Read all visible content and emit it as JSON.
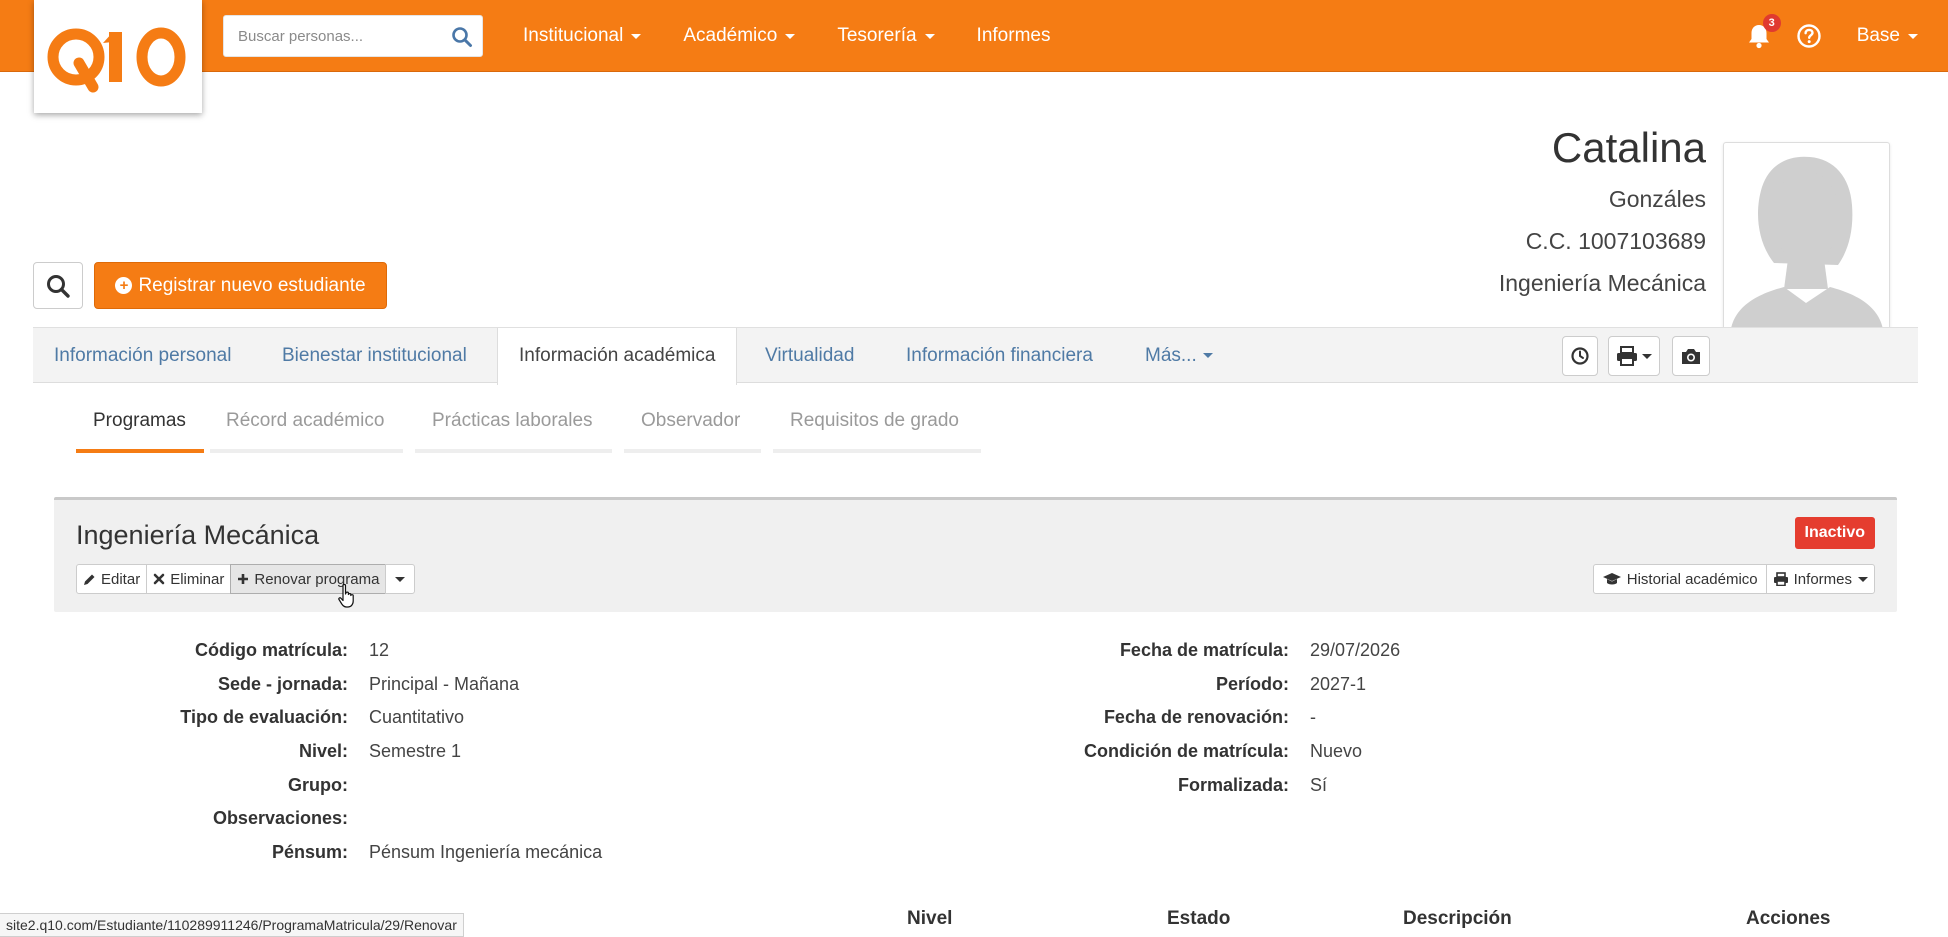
{
  "navbar": {
    "logo_text": "Q10",
    "search_placeholder": "Buscar personas...",
    "menu": [
      {
        "label": "Institucional",
        "has_caret": true
      },
      {
        "label": "Académico",
        "has_caret": true
      },
      {
        "label": "Tesorería",
        "has_caret": true
      },
      {
        "label": "Informes",
        "has_caret": false
      }
    ],
    "notifications_count": "3",
    "user_label": "Base",
    "icons": [
      "search-icon",
      "bell-icon",
      "question-circle-icon",
      "caret-down-icon"
    ]
  },
  "profile": {
    "first_name": "Catalina",
    "last_name": "Gonzáles",
    "document": "C.C. 1007103689",
    "program": "Ingeniería Mecánica"
  },
  "actions": {
    "register_label": "Registrar nuevo estudiante"
  },
  "main_tabs": [
    {
      "label": "Información personal",
      "active": false
    },
    {
      "label": "Bienestar institucional",
      "active": false
    },
    {
      "label": "Información académica",
      "active": true
    },
    {
      "label": "Virtualidad",
      "active": false
    },
    {
      "label": "Información financiera",
      "active": false
    },
    {
      "label": "Más...",
      "active": false
    }
  ],
  "sub_tabs": [
    {
      "label": "Programas",
      "active": true
    },
    {
      "label": "Récord académico",
      "active": false
    },
    {
      "label": "Prácticas laborales",
      "active": false
    },
    {
      "label": "Observador",
      "active": false
    },
    {
      "label": "Requisitos de grado",
      "active": false
    }
  ],
  "program_panel": {
    "title": "Ingeniería Mecánica",
    "status": "Inactivo",
    "buttons_left": {
      "edit": "Editar",
      "delete": "Eliminar",
      "renew": "Renovar programa"
    },
    "buttons_right": {
      "history": "Historial académico",
      "reports": "Informes"
    }
  },
  "details_left": [
    {
      "label": "Código matrícula:",
      "value": "12"
    },
    {
      "label": "Sede - jornada:",
      "value": "Principal - Mañana"
    },
    {
      "label": "Tipo de evaluación:",
      "value": "Cuantitativo"
    },
    {
      "label": "Nivel:",
      "value": "Semestre 1"
    },
    {
      "label": "Grupo:",
      "value": ""
    },
    {
      "label": "Observaciones:",
      "value": ""
    },
    {
      "label": "Pénsum:",
      "value": "Pénsum Ingeniería mecánica"
    }
  ],
  "details_right": [
    {
      "label": "Fecha de matrícula:",
      "value": "29/07/2026"
    },
    {
      "label": "Período:",
      "value": "2027-1"
    },
    {
      "label": "Fecha de renovación:",
      "value": "-"
    },
    {
      "label": "Condición de matrícula:",
      "value": "Nuevo"
    },
    {
      "label": "Formalizada:",
      "value": "Sí"
    }
  ],
  "table_headers": [
    "Nivel",
    "Estado",
    "Descripción",
    "Acciones"
  ],
  "status_url": "site2.q10.com/Estudiante/110289911246/ProgramaMatricula/29/Renovar",
  "colors": {
    "brand": "#f57c14",
    "inactive_badge": "#e53d2f",
    "tab_link": "#4f7aa5"
  }
}
